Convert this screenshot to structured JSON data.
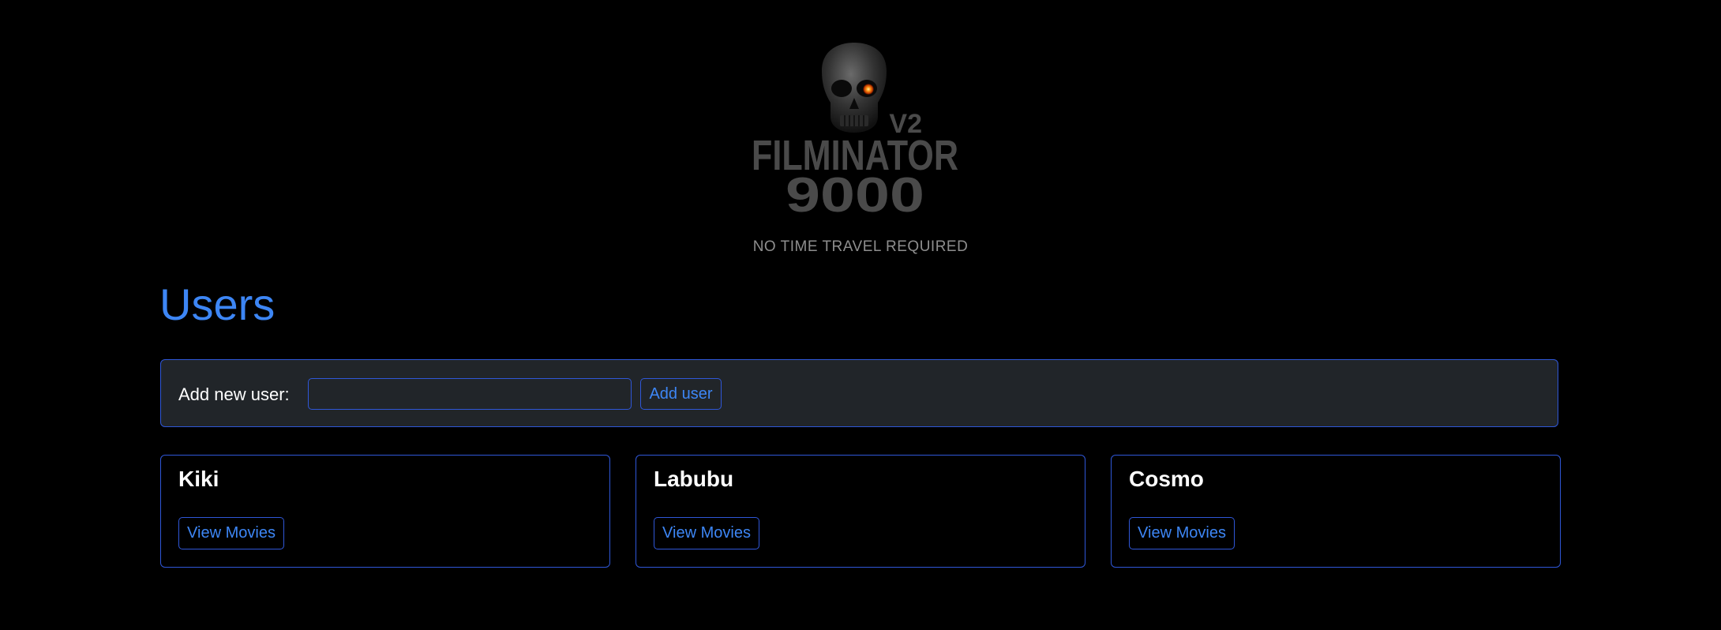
{
  "logo": {
    "version": "V2",
    "line1": "FILMINATOR",
    "line2": "9000",
    "icon": "skull-icon"
  },
  "tagline": "NO TIME TRAVEL REQUIRED",
  "heading": "Users",
  "add_user": {
    "label": "Add new user:",
    "input_value": "",
    "input_placeholder": "",
    "button_label": "Add user"
  },
  "users": [
    {
      "name": "Kiki",
      "button_label": "View Movies"
    },
    {
      "name": "Labubu",
      "button_label": "View Movies"
    },
    {
      "name": "Cosmo",
      "button_label": "View Movies"
    }
  ],
  "colors": {
    "background": "#000000",
    "accent": "#3d86f5",
    "border": "#2f57d8",
    "panel": "#212529",
    "muted_text": "#8e8e8e"
  }
}
